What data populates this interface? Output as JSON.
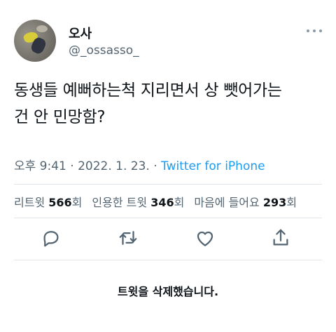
{
  "author": {
    "display_name": "오사",
    "handle": "@_ossasso_"
  },
  "tweet": {
    "text_line1": "동생들 예뻐하는척 지리면서 상 뺏어가는",
    "text_line2": "건 안 민망함?",
    "time": "오후 9:41",
    "date": "2022. 1. 23.",
    "separator": "·",
    "source": "Twitter for iPhone"
  },
  "stats": {
    "retweets_label": "리트윗",
    "retweets_count": "566",
    "retweets_suffix": "회",
    "quotes_label": "인용한 트윗",
    "quotes_count": "346",
    "quotes_suffix": "회",
    "likes_label": "마음에 들어요",
    "likes_count": "293",
    "likes_suffix": "회"
  },
  "actions": [
    "reply-icon",
    "retweet-icon",
    "like-icon",
    "share-icon"
  ],
  "notice": "트윗을 삭제했습니다.",
  "colors": {
    "text": "#0f1419",
    "secondary": "#536471",
    "link": "#1d9bf0",
    "divider": "#e1e6ea"
  }
}
